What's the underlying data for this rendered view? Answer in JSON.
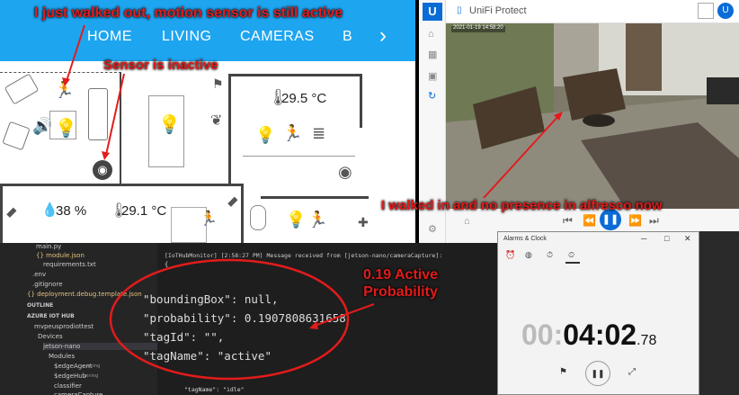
{
  "annotations": {
    "top_left": "I just walked out, motion sensor is still active",
    "sensor": "Sensor is inactive",
    "camera": "I walked in and no presence in alfresco now",
    "probability": "0.19 Active\nProbability"
  },
  "home": {
    "nav": [
      "HOME",
      "LIVING",
      "CAMERAS",
      "B",
      "›"
    ],
    "temps": [
      "29.5 °C",
      "38 %",
      "29.1 °C"
    ]
  },
  "protect": {
    "title": "UniFi Protect",
    "timestamp": "2021-01-19 14:58:20"
  },
  "vscode": {
    "tree": [
      "main.py",
      "{} module.json",
      "requirements.txt",
      ".env",
      ".gitignore",
      "{} deployment.debug.template.json",
      "OUTLINE",
      "AZURE IOT HUB",
      "mvpeusprodiottest",
      "Devices",
      "jetson-nano",
      "Modules",
      "$edgeAgent",
      "$edgeHub",
      "classifier",
      "cameraCapture"
    ],
    "tree_status": "running",
    "output_header": "[IoTHubMonitor] [2:58:27 PM] Message received from [jetson-nano/cameraCapture]:",
    "json_lines": [
      "\"boundingBox\": null,",
      "\"probability\": 0.1907808631658",
      "\"tagId\": \"\",",
      "\"tagName\": \"active\""
    ],
    "brace": "{",
    "bottom_line": "\"tagName\": \"idle\""
  },
  "alarms": {
    "title": "Alarms & Clock",
    "time_dim": "00:",
    "time_main": "04:02",
    "time_frac": ".78"
  },
  "colors": {
    "accent_blue": "#1ea5f0",
    "annotation_red": "#e31b1b",
    "vscode_bg": "#1e1e1e"
  }
}
